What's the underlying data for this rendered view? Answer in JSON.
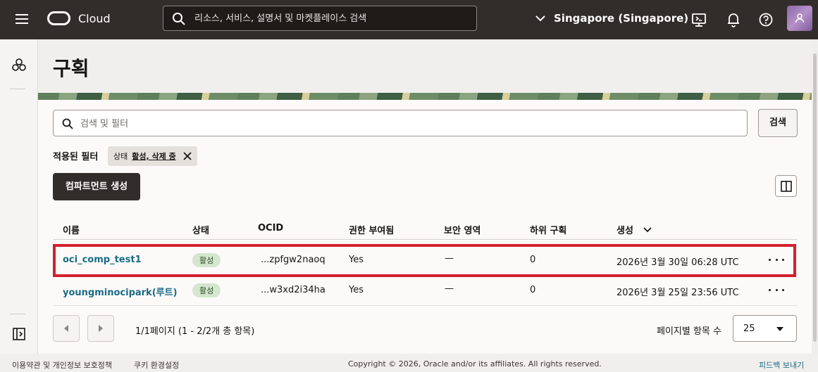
{
  "topbar": {
    "app_name": "Cloud",
    "search_placeholder": "리소스, 서비스, 설명서 및 마켓플레이스 검색",
    "region": "Singapore (Singapore)"
  },
  "page": {
    "title": "구획"
  },
  "filter": {
    "placeholder": "검색 및 필터",
    "search_button": "검색",
    "applied_label": "적용된 필터",
    "chip_key": "상태",
    "chip_values": "활성, 삭제 중"
  },
  "actions": {
    "create_label": "컴파트먼트 생성"
  },
  "table": {
    "headers": {
      "name": "이름",
      "state": "상태",
      "ocid": "OCID",
      "authorized": "권한 부여됨",
      "security_zone": "보안 영역",
      "subcompartments": "하위 구획",
      "created": "생성"
    },
    "rows": [
      {
        "name": "oci_comp_test1",
        "state": "활성",
        "ocid": "...zpfgw2naoq",
        "authorized": "Yes",
        "security_zone": "—",
        "subcompartments": "0",
        "created": "2026년 3월 30일 06:28 UTC"
      },
      {
        "name": "youngminocipark(루트)",
        "state": "활성",
        "ocid": "...w3xd2i34ha",
        "authorized": "Yes",
        "security_zone": "—",
        "subcompartments": "0",
        "created": "2026년 3월 25일 23:56 UTC"
      }
    ]
  },
  "pagination": {
    "summary": "1/1페이지 (1 - 2/2개 총 항목)",
    "per_page_label": "페이지별 항목 수",
    "per_page_value": "25"
  },
  "footer": {
    "terms": "이용약관 및 개인정보 보호정책",
    "cookies": "쿠키 환경설정",
    "copyright": "Copyright © 2026, Oracle and/or its affiliates. All rights reserved.",
    "feedback": "피드백 보내기"
  },
  "colors": {
    "topbar_bg": "#312d2a",
    "link": "#1b6b86",
    "highlight": "#d3202e",
    "active_badge": "#d4e6cd"
  }
}
